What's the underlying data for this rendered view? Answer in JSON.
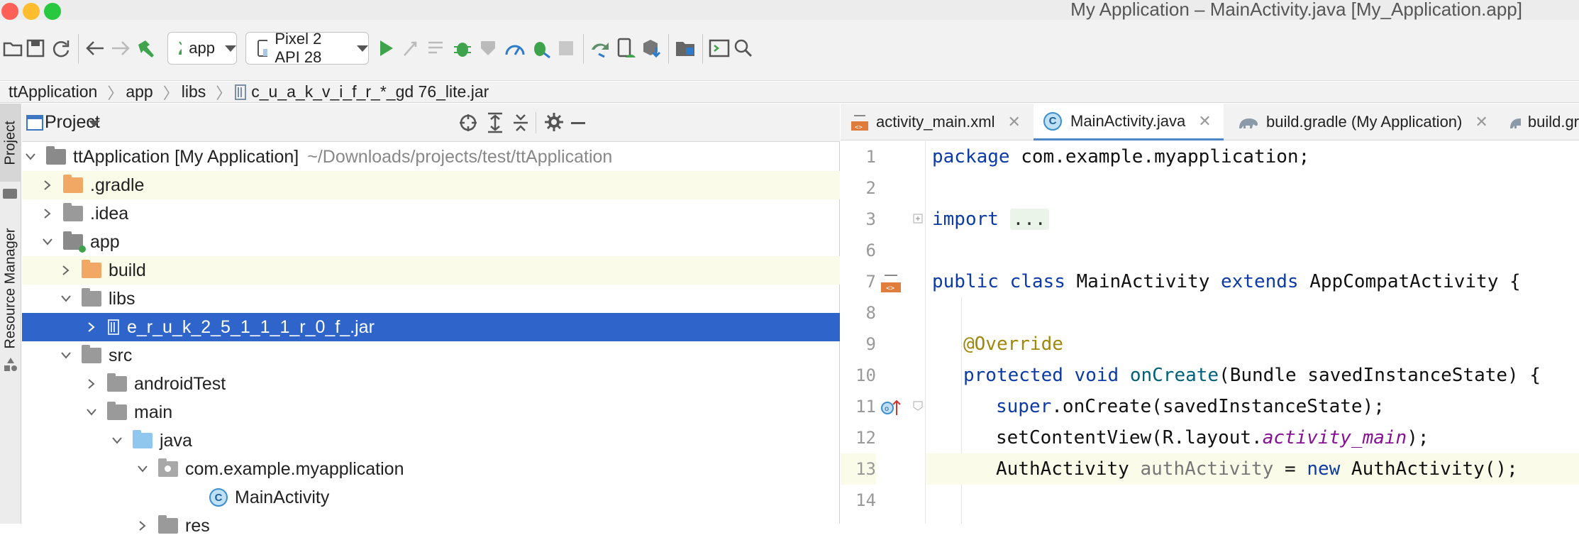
{
  "window": {
    "title": "My Application – MainActivity.java [My_Application.app]"
  },
  "toolbar": {
    "run_config": "app",
    "device": "Pixel 2 API 28"
  },
  "breadcrumb": {
    "items": [
      "ttApplication",
      "app",
      "libs",
      "c_u_a_k_v_i_f_r_*_gd  76_lite.jar"
    ]
  },
  "side_tabs": {
    "project": "Project",
    "resource_manager": "Resource Manager"
  },
  "project_panel": {
    "title": "Project",
    "tree": [
      {
        "label": "ttApplication [My Application]",
        "path": "~/Downloads/projects/test/ttApplication"
      },
      {
        "label": ".gradle"
      },
      {
        "label": ".idea"
      },
      {
        "label": "app"
      },
      {
        "label": "build"
      },
      {
        "label": "libs"
      },
      {
        "label": "e_r_u_k_2_5_1_1_1_r_0_f_.jar"
      },
      {
        "label": "src"
      },
      {
        "label": "androidTest"
      },
      {
        "label": "main"
      },
      {
        "label": "java"
      },
      {
        "label": "com.example.myapplication"
      },
      {
        "label": "MainActivity"
      },
      {
        "label": "res"
      }
    ]
  },
  "editor": {
    "tabs": [
      {
        "label": "activity_main.xml"
      },
      {
        "label": "MainActivity.java"
      },
      {
        "label": "build.gradle (My Application)"
      },
      {
        "label": "build.gr"
      }
    ],
    "line_numbers": [
      "1",
      "2",
      "3",
      "6",
      "7",
      "8",
      "9",
      "10",
      "11",
      "12",
      "13",
      "14"
    ],
    "code": {
      "l1_kw": "package",
      "l1_rest": " com.example.myapplication;",
      "l3_kw": "import",
      "l3_fold": "...",
      "l7_kw1": "public",
      "l7_kw2": "class",
      "l7_name": "MainActivity",
      "l7_kw3": "extends",
      "l7_rest": " AppCompatActivity {",
      "l9_ann": "@Override",
      "l10_kw1": "protected",
      "l10_kw2": "void",
      "l10_fn": "onCreate",
      "l10_rest": "(Bundle savedInstanceState) {",
      "l11_kw": "super",
      "l11_rest": ".onCreate(savedInstanceState);",
      "l12_a": "setContentView(R.layout.",
      "l12_fld": "activity_main",
      "l12_b": ");",
      "l13_a": "AuthActivity ",
      "l13_var": "authActivity",
      "l13_b": " = ",
      "l13_kw": "new",
      "l13_c": " AuthActivity();"
    }
  },
  "colors": {
    "selection": "#2f65ca",
    "highlight_row": "#fbfbe9",
    "run_green": "#3fa34d"
  }
}
